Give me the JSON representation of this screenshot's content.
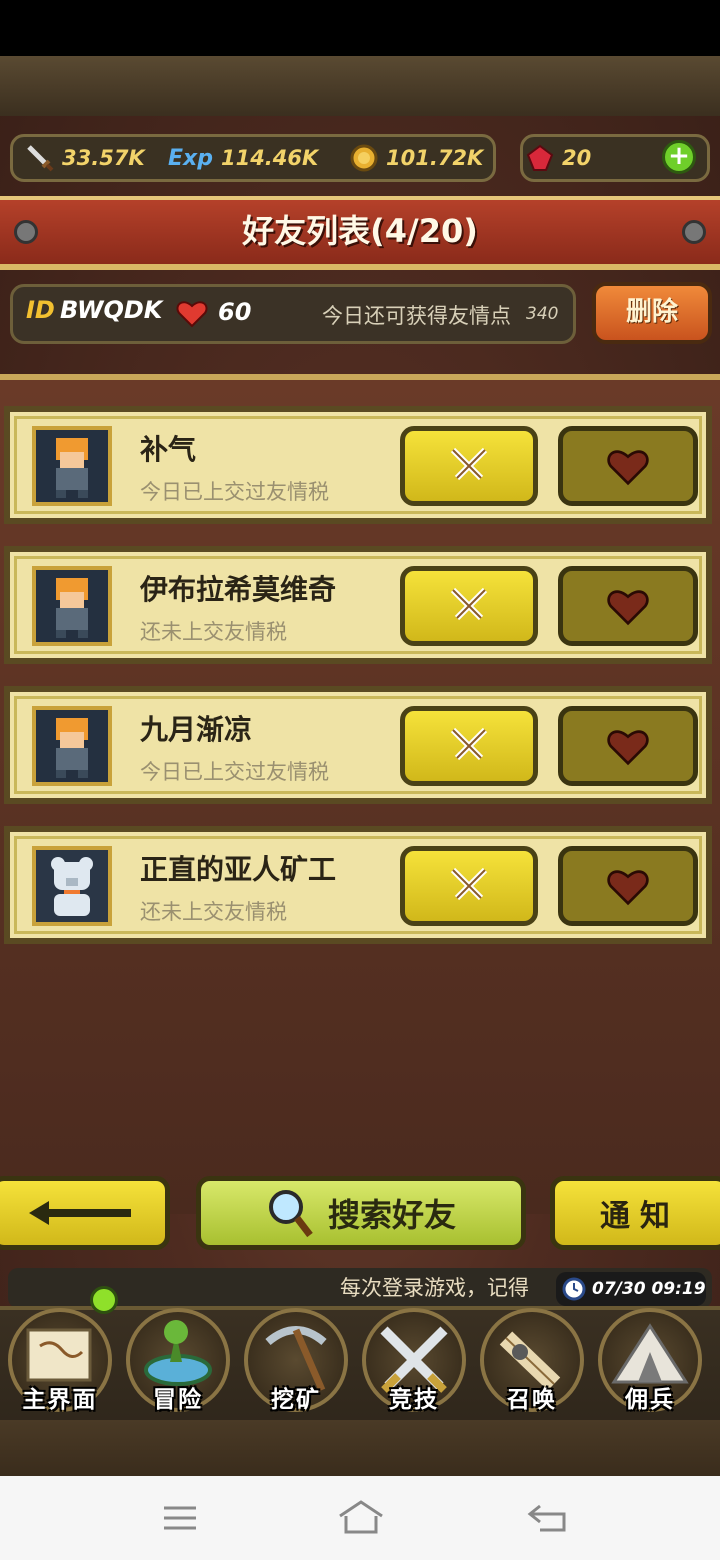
{
  "resources": {
    "attack": "33.57K",
    "exp_label": "Exp",
    "exp": "114.46K",
    "gold": "101.72K",
    "gems": "20"
  },
  "title": "好友列表(4/20)",
  "info": {
    "id_label": "ID",
    "id_value": "BWQDK",
    "hearts": "60",
    "friendship_text": "今日还可获得友情点",
    "friendship_points": "340",
    "delete_label": "删除"
  },
  "friends": [
    {
      "name": "补气",
      "status": "今日已上交过友情税",
      "avatar": "hero-avatar"
    },
    {
      "name": "伊布拉希莫维奇",
      "status": "还未上交友情税",
      "avatar": "hero-avatar"
    },
    {
      "name": "九月渐凉",
      "status": "今日已上交过友情税",
      "avatar": "hero-avatar"
    },
    {
      "name": "正直的亚人矿工",
      "status": "还未上交友情税",
      "avatar": "bear-avatar"
    }
  ],
  "actions": {
    "search_label": "搜索好友",
    "notify_label": "通知"
  },
  "ticker": "每次登录游戏，记得",
  "clock": "07/30 09:19",
  "nav": [
    {
      "label": "主界面",
      "icon": "map-scroll-icon"
    },
    {
      "label": "冒险",
      "icon": "island-icon"
    },
    {
      "label": "挖矿",
      "icon": "pickaxe-icon"
    },
    {
      "label": "竞技",
      "icon": "crossed-swords-icon"
    },
    {
      "label": "召唤",
      "icon": "scroll-icon"
    },
    {
      "label": "佣兵",
      "icon": "tent-icon"
    }
  ]
}
